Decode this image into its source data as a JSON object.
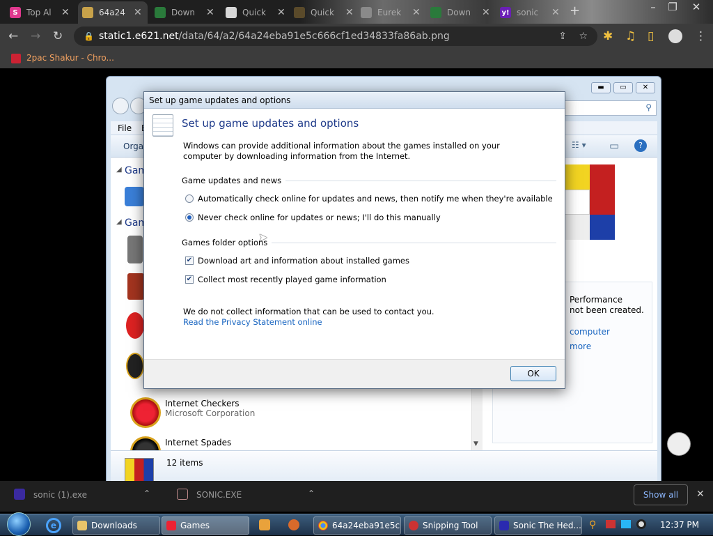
{
  "browser": {
    "tabs": [
      {
        "title": "Top Al",
        "favicon_color": "#e0388e",
        "favicon_letter": "S"
      },
      {
        "title": "64a24",
        "favicon_color": "#c8a24a",
        "favicon_letter": "",
        "active": true
      },
      {
        "title": "Down",
        "favicon_color": "#2a7a3b",
        "favicon_letter": ""
      },
      {
        "title": "Quick",
        "favicon_color": "#d8d8d8",
        "favicon_letter": ""
      },
      {
        "title": "Quick",
        "favicon_color": "#5a4a2a",
        "favicon_letter": ""
      },
      {
        "title": "Eurek",
        "favicon_color": "#8a8a8a",
        "favicon_letter": ""
      },
      {
        "title": "Down",
        "favicon_color": "#2a7a3b",
        "favicon_letter": ""
      },
      {
        "title": "sonic",
        "favicon_color": "#6a1fb5",
        "favicon_letter": "y!"
      }
    ],
    "new_tab": "+",
    "url_host": "static1.e621.net",
    "url_path": "/data/64/a2/64a24eba91e5c666cf1ed34833fa86ab.png",
    "bookmark": "2pac Shakur - Chro..."
  },
  "explorer": {
    "menu_file": "File",
    "menu_edit": "E",
    "organize": "Orga",
    "group1": "Gam",
    "group2": "Gam",
    "games": [
      {
        "name": "Internet Checkers",
        "publisher": "Microsoft Corporation"
      },
      {
        "name": "Internet Spades",
        "publisher": ""
      }
    ],
    "status_items": "12 items",
    "side_perf": "Performance",
    "side_notcreated": "not been created.",
    "side_computer": "computer",
    "side_more": "more"
  },
  "dialog": {
    "title": "Set up game updates and options",
    "heading": "Set up game updates and options",
    "intro": "Windows can provide additional information about the games installed on your computer by downloading information from the Internet.",
    "section_updates": "Game updates and news",
    "radio_auto": "Automatically check online for updates and news, then notify me when they're available",
    "radio_never": "Never check online for updates or news; I'll do this manually",
    "section_folder": "Games folder options",
    "check_art": "Download art and information about installed games",
    "check_recent": "Collect most recently played game information",
    "privacy_note": "We do not collect information that can be used to contact you.",
    "privacy_link": "Read the Privacy Statement online",
    "ok": "OK",
    "radio_selected": "never",
    "check_art_checked": true,
    "check_recent_checked": true
  },
  "shelf": {
    "item1": "sonic (1).exe",
    "item2": "SONIC.EXE",
    "show_all": "Show all"
  },
  "taskbar": {
    "buttons": [
      "Downloads",
      "Games",
      "64a24eba91e5c...",
      "Snipping Tool",
      "Sonic The Hed..."
    ],
    "clock": "12:37 PM"
  }
}
